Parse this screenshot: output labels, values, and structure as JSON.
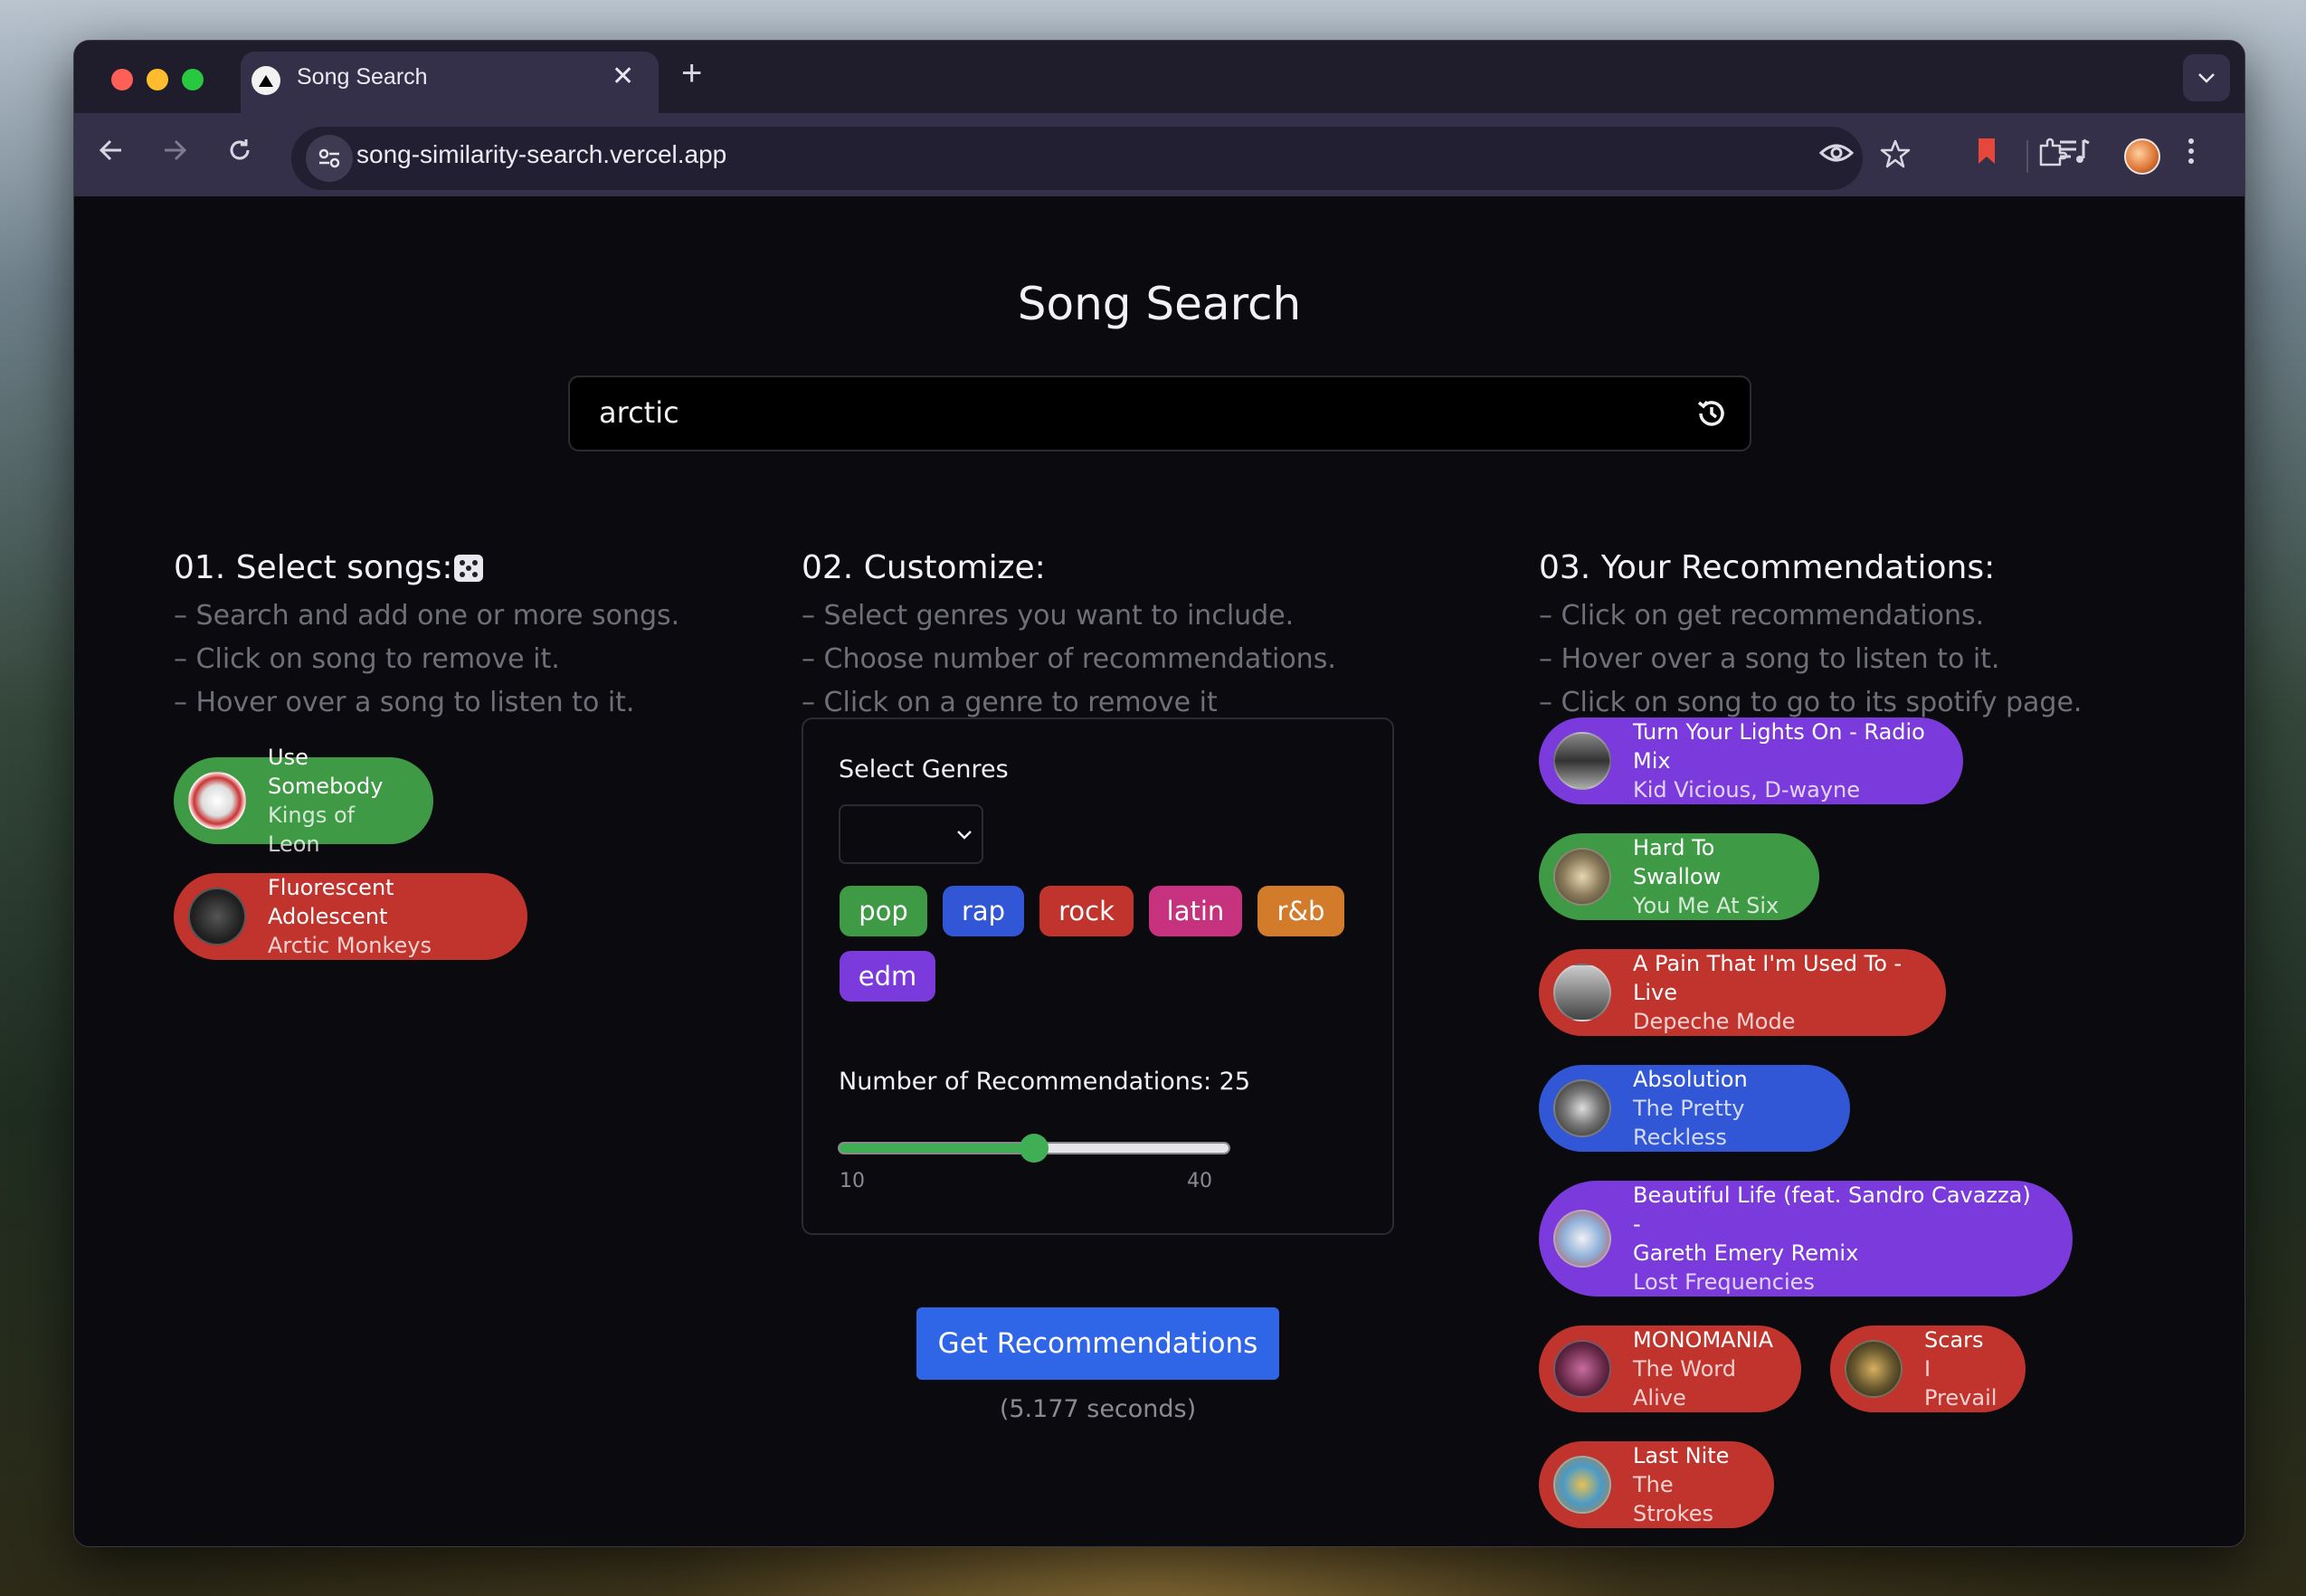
{
  "browser": {
    "tab_title": "Song Search",
    "tab_close": "✕",
    "new_tab": "+",
    "url": "song-similarity-search.vercel.app"
  },
  "page": {
    "title": "Song Search",
    "search_value": "arctic"
  },
  "select_section": {
    "heading": "01. Select songs:",
    "instructions": [
      "– Search and add one or more songs.",
      "– Click on song to remove it.",
      "– Hover over a song to listen to it."
    ],
    "songs": [
      {
        "title": "Use Somebody",
        "artist": "Kings of Leon",
        "color": "#3f9a45"
      },
      {
        "title": "Fluorescent Adolescent",
        "artist": "Arctic Monkeys",
        "color": "#c1342d"
      }
    ]
  },
  "customize_section": {
    "heading": "02. Customize:",
    "instructions": [
      "– Select genres you want to include.",
      "– Choose number of recommendations.",
      "– Click on a genre to remove it"
    ],
    "select_genres_label": "Select Genres",
    "genres": [
      "pop",
      "rap",
      "rock",
      "latin",
      "r&b",
      "edm"
    ],
    "num_recs_label": "Number of Recommendations: 25",
    "num_recs_value": 25,
    "slider_min": "10",
    "slider_max": "40",
    "get_button": "Get Recommendations",
    "timing": "(5.177 seconds)"
  },
  "recs_section": {
    "heading": "03. Your Recommendations:",
    "instructions": [
      "– Click on get recommendations.",
      "– Hover over a song to listen to it.",
      "– Click on song to go to its spotify page."
    ],
    "songs": [
      {
        "title": "Turn Your Lights On - Radio Mix",
        "artist": "Kid Vicious, D-wayne",
        "color": "#7b3bdc"
      },
      {
        "title": "Hard To Swallow",
        "artist": "You Me At Six",
        "color": "#3f9a45"
      },
      {
        "title": "A Pain That I'm Used To - Live",
        "artist": "Depeche Mode",
        "color": "#c1342d"
      },
      {
        "title": "Absolution",
        "artist": "The Pretty Reckless",
        "color": "#3257d6"
      },
      {
        "title_line1": "Beautiful Life (feat. Sandro Cavazza) -",
        "title_line2": "Gareth Emery Remix",
        "artist": "Lost Frequencies",
        "color": "#7b3bdc"
      },
      {
        "title": "MONOMANIA",
        "artist": "The Word Alive",
        "color": "#c1342d"
      },
      {
        "title": "Scars",
        "artist": "I Prevail",
        "color": "#c1342d"
      },
      {
        "title": "Last Nite",
        "artist": "The Strokes",
        "color": "#c1342d"
      }
    ]
  },
  "icons": {
    "history": "history-icon",
    "dice": "dice-icon"
  }
}
